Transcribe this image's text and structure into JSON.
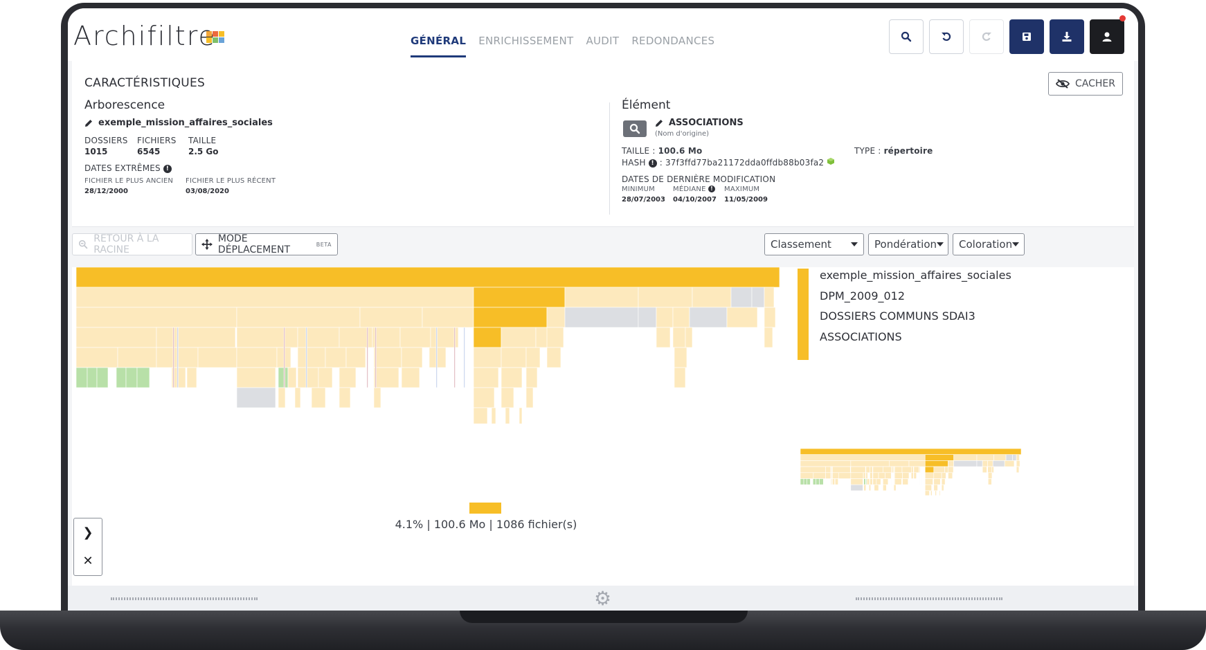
{
  "app": {
    "logo_text": "Archifiltre",
    "tabs": [
      "GÉNÉRAL",
      "ENRICHISSEMENT",
      "AUDIT",
      "REDONDANCES"
    ],
    "active_tab": "GÉNÉRAL",
    "icons": {
      "search": "search-icon",
      "undo": "undo-icon",
      "redo": "redo-icon",
      "save": "save-icon",
      "download": "download-icon",
      "user": "user-icon"
    }
  },
  "characteristics": {
    "title": "CARACTÉRISTIQUES",
    "hide_label": "CACHER",
    "tree": {
      "heading": "Arborescence",
      "name": "exemple_mission_affaires_sociales",
      "dossiers_label": "DOSSIERS",
      "dossiers_value": "1015",
      "fichiers_label": "FICHIERS",
      "fichiers_value": "6545",
      "taille_label": "TAILLE",
      "taille_value": "2.5 Go",
      "dates_label": "DATES EXTRÊMES",
      "oldest_label": "FICHIER LE PLUS ANCIEN",
      "oldest_value": "28/12/2000",
      "newest_label": "FICHIER LE PLUS RÉCENT",
      "newest_value": "03/08/2020"
    },
    "element": {
      "heading": "Élément",
      "name": "ASSOCIATIONS",
      "origin_note": "(Nom d'origine)",
      "taille_label": "TAILLE :",
      "taille_value": "100.6 Mo",
      "type_label": "TYPE :",
      "type_value": "répertoire",
      "hash_label": "HASH",
      "hash_value": ": 37f3ffd77ba21172dda0ffdb88b03fa2",
      "dates_label": "DATES DE DERNIÈRE MODIFICATION",
      "min_label": "MINIMUM",
      "min_value": "28/07/2003",
      "median_label": "MÉDIANE",
      "median_value": "04/10/2007",
      "max_label": "MAXIMUM",
      "max_value": "11/05/2009"
    }
  },
  "toolbar": {
    "back_to_root": "RETOUR À LA RACINE",
    "move_mode": "MODE DÉPLACEMENT",
    "beta": "BETA",
    "sort": "Classement",
    "weight": "Pondération",
    "color": "Coloration"
  },
  "viz": {
    "breadcrumb": [
      "exemple_mission_affaires_sociales",
      "DPM_2009_012",
      "DOSSIERS COMMUNS SDAI3",
      "ASSOCIATIONS"
    ],
    "stats": "4.1% | 100.6 Mo | 1086 fichier(s)",
    "colors": {
      "accent": "#f7be27",
      "light": "#fde9bd",
      "grey": "#dcdee2",
      "green": "#b8e0a8"
    }
  },
  "side_controls": {
    "expand_icon": "chevron-right-icon",
    "close_icon": "close-icon"
  },
  "footer": {
    "icon": "gear-icon"
  }
}
